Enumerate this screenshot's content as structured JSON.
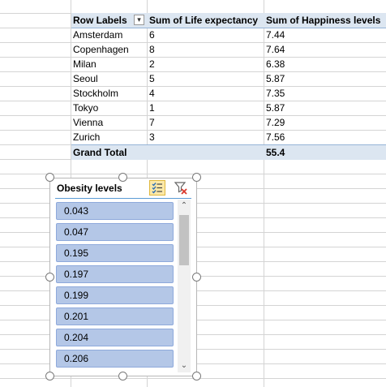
{
  "pivot": {
    "headers": {
      "row_labels": "Row Labels",
      "life": "Sum of Life expectancy",
      "happiness": "Sum of Happiness levels"
    },
    "rows": [
      {
        "city": "Amsterdam",
        "life": "6",
        "happiness": "7.44"
      },
      {
        "city": "Copenhagen",
        "life": "8",
        "happiness": "7.64"
      },
      {
        "city": "Milan",
        "life": "2",
        "happiness": "6.38"
      },
      {
        "city": "Seoul",
        "life": "5",
        "happiness": "5.87"
      },
      {
        "city": "Stockholm",
        "life": "4",
        "happiness": "7.35"
      },
      {
        "city": "Tokyo",
        "life": "1",
        "happiness": "5.87"
      },
      {
        "city": "Vienna",
        "life": "7",
        "happiness": "7.29"
      },
      {
        "city": "Zurich",
        "life": "3",
        "happiness": "7.56"
      }
    ],
    "total": {
      "label": "Grand Total",
      "life": "",
      "happiness": "55.4"
    }
  },
  "slicer": {
    "title": "Obesity levels",
    "items": [
      "0.043",
      "0.047",
      "0.195",
      "0.197",
      "0.199",
      "0.201",
      "0.204",
      "0.206"
    ],
    "colors": {
      "item_fill": "#b4c7e7",
      "header_fill": "#dce6f1",
      "multiselect": "#fbe8a8"
    },
    "icons": {
      "multiselect": "multi-select-icon",
      "clear": "clear-filter-icon",
      "scroll_up": "chevron-up-icon",
      "scroll_down": "chevron-down-icon"
    }
  }
}
